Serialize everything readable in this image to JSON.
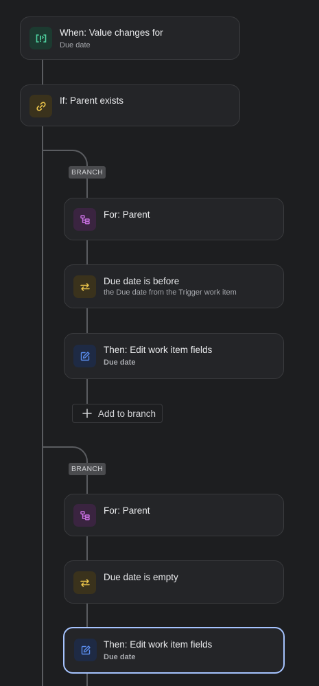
{
  "trigger": {
    "title": "When: Value changes for",
    "subtitle": "Due date",
    "icon": "code-brackets-icon",
    "icon_bg": "#1c3a30",
    "icon_color": "#4fd1a0"
  },
  "condition": {
    "title": "If: Parent exists",
    "icon": "link-icon",
    "icon_bg": "#3a321c",
    "icon_color": "#e8c24a"
  },
  "branches": [
    {
      "label": "BRANCH",
      "for_card": {
        "title": "For: Parent",
        "icon": "hierarchy-icon"
      },
      "compare_card": {
        "title": "Due date is before",
        "subtitle": "the Due date from the Trigger work item",
        "icon": "swap-arrows-icon"
      },
      "action_card": {
        "title": "Then: Edit work item fields",
        "subtitle": "Due date",
        "icon": "edit-icon"
      },
      "add_button": "Add to branch"
    },
    {
      "label": "BRANCH",
      "for_card": {
        "title": "For: Parent",
        "icon": "hierarchy-icon"
      },
      "compare_card": {
        "title": "Due date is empty",
        "icon": "swap-arrows-icon"
      },
      "action_card": {
        "title": "Then: Edit work item fields",
        "subtitle": "Due date",
        "icon": "edit-icon",
        "selected": true
      }
    }
  ],
  "colors": {
    "background": "#1d1e20",
    "card": "#242528",
    "connector": "#5a5c60",
    "selected_border": "#a6c4ff",
    "branch_icon_bg": "#3a2440",
    "branch_icon_color": "#c86ee0",
    "compare_icon_bg": "#3a321c",
    "compare_icon_color": "#e8c24a",
    "edit_icon_bg": "#1e2a44",
    "edit_icon_color": "#5b8ef0"
  }
}
